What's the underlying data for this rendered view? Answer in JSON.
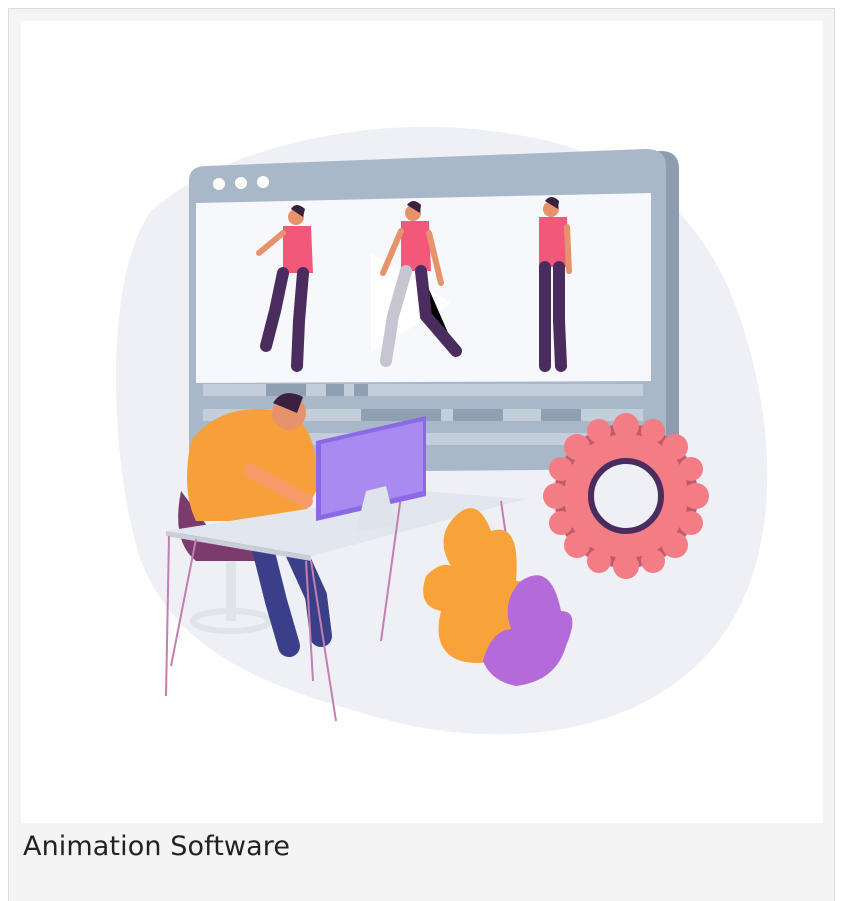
{
  "card": {
    "caption": "Animation Software"
  },
  "illustration": {
    "subject": "person-at-desk-animating-walking-figures",
    "colors": {
      "blob": "#eef0f6",
      "window_frame": "#a9b8c8",
      "window_shadow": "#8d9cae",
      "screen": "#f7f8fb",
      "timeline_track": "#c4ceda",
      "timeline_mark": "#8fa0b3",
      "shirt_pink": "#f1587a",
      "pants_purple": "#4a2d5e",
      "sweater_orange": "#f7a03b",
      "monitor_purple": "#8b69e6",
      "gear_pink": "#f27d84",
      "leaf_orange": "#f8a23a",
      "leaf_purple": "#b46ad9",
      "desk": "#e2e6ee",
      "desk_leg": "#c27fb0"
    }
  }
}
